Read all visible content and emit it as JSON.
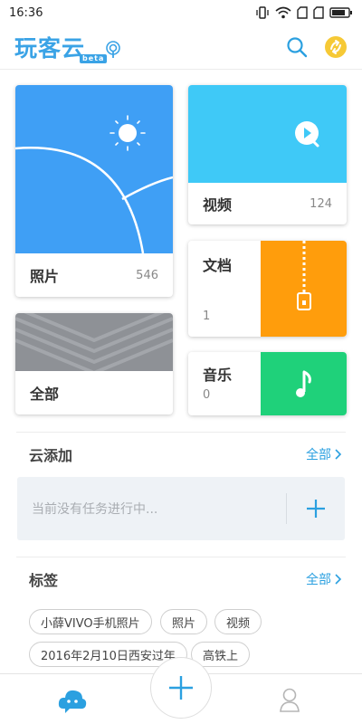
{
  "status_bar": {
    "time": "16:36"
  },
  "header": {
    "app_title": "玩客云",
    "beta_label": "beta"
  },
  "tiles": {
    "photos": {
      "label": "照片",
      "count": "546"
    },
    "videos": {
      "label": "视频",
      "count": "124"
    },
    "documents": {
      "label": "文档",
      "count": "1"
    },
    "all": {
      "label": "全部"
    },
    "music": {
      "label": "音乐",
      "count": "0"
    }
  },
  "cloud_add": {
    "title": "云添加",
    "more_label": "全部",
    "empty_text": "当前没有任务进行中..."
  },
  "tags_section": {
    "title": "标签",
    "more_label": "全部",
    "tags": [
      "小薛VIVO手机照片",
      "照片",
      "视频",
      "2016年2月10日西安过年",
      "高铁上"
    ]
  },
  "colors": {
    "accent": "#2ba0e0",
    "photos_tile": "#3f9ff5",
    "videos_tile": "#3fc9f7",
    "documents_tile": "#ff9d0c",
    "music_tile": "#1fd17a",
    "all_tile": "#8e9196"
  },
  "icons": {
    "search": "search-icon",
    "account": "account-badge-icon",
    "add": "plus-icon",
    "home": "home-cloud-icon",
    "profile": "profile-icon"
  }
}
